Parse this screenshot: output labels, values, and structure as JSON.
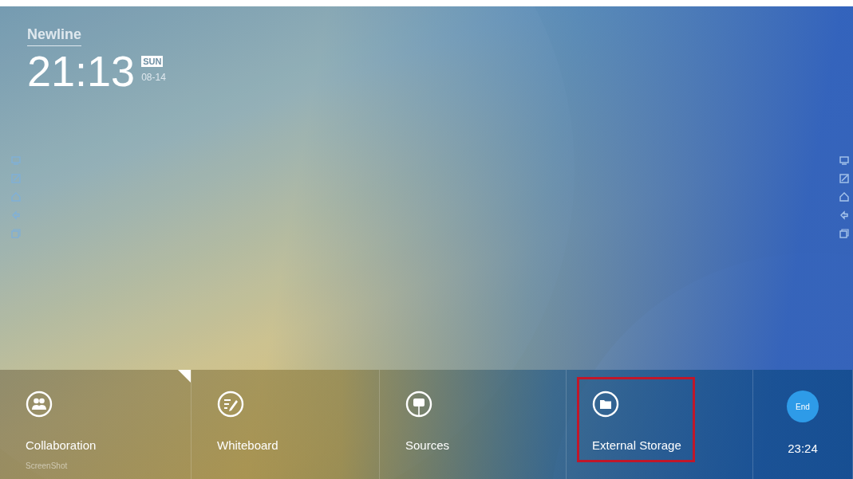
{
  "logo": "Newline",
  "clock": {
    "time": "21:13",
    "day": "SUN",
    "date": "08-14"
  },
  "dock": [
    {
      "kind": "app",
      "label": "Collaboration",
      "sublabel": "ScreenShot",
      "selected": true,
      "highlighted": false
    },
    {
      "kind": "app",
      "label": "Whiteboard",
      "selected": false,
      "highlighted": false
    },
    {
      "kind": "app",
      "label": "Sources",
      "selected": false,
      "highlighted": false
    },
    {
      "kind": "app",
      "label": "External Storage",
      "selected": false,
      "highlighted": true
    },
    {
      "kind": "timer",
      "badge": "End",
      "label": "23:24",
      "selected": false,
      "highlighted": false
    }
  ]
}
